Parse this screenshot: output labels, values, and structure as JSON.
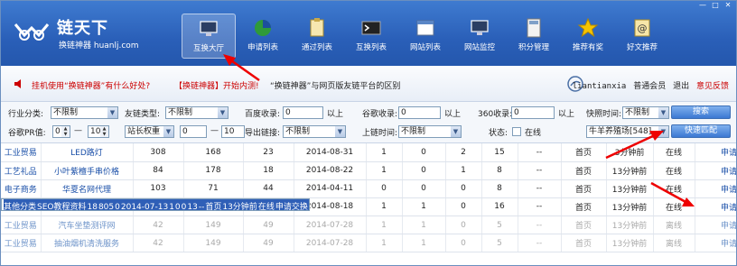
{
  "brand": {
    "name": "链天下",
    "sub": "换链神器 huanlj.com"
  },
  "window": {
    "min": "—",
    "max": "□",
    "close": "✕"
  },
  "nav": [
    {
      "label": "互换大厅",
      "icon": "monitor-icon",
      "active": true
    },
    {
      "label": "申请列表",
      "icon": "pie-chart-icon",
      "active": false
    },
    {
      "label": "通过列表",
      "icon": "clipboard-icon",
      "active": false
    },
    {
      "label": "互换列表",
      "icon": "terminal-icon",
      "active": false
    },
    {
      "label": "网站列表",
      "icon": "browser-window-icon",
      "active": false
    },
    {
      "label": "网站监控",
      "icon": "monitor-icon",
      "active": false
    },
    {
      "label": "积分管理",
      "icon": "calculator-icon",
      "active": false
    },
    {
      "label": "推荐有奖",
      "icon": "star-icon",
      "active": false
    },
    {
      "label": "好文推荐",
      "icon": "at-sign-icon",
      "active": false
    }
  ],
  "info": {
    "t1": "挂机使用“换链神器”有什么好处?",
    "t2": "【换链神器】开始内测!",
    "t3": "“换链神器”与网页版友链平台的区别"
  },
  "user": {
    "name": "liantianxia",
    "level": "普通会员",
    "logout": "退出",
    "feedback": "意见反馈"
  },
  "filter": {
    "industry_label": "行业分类:",
    "industry_value": "不限制",
    "linktype_label": "友链类型:",
    "linktype_value": "不限制",
    "baidu_label": "百度收录:",
    "baidu_value": "0",
    "baidu_unit": "以上",
    "google_label": "谷歌收录:",
    "google_value": "0",
    "google_unit": "以上",
    "s360_label": "360收录:",
    "s360_value": "0",
    "s360_unit": "以上",
    "snapshot_label": "快照时间:",
    "snapshot_value": "不限制",
    "search_btn": "搜索",
    "pr_label": "谷歌PR值:",
    "pr_from": "0",
    "pr_sep": "—",
    "pr_to": "10",
    "weight_value": "站长权重",
    "w_from": "0",
    "w_sep": "—",
    "w_to": "10",
    "outlinks_label": "导出链接:",
    "outlinks_value": "不限制",
    "online_time_label": "上链时间:",
    "online_time_value": "不限制",
    "status_label": "状态:",
    "status_option": "在线",
    "site_value": "牛羊养殖场[548]",
    "match_btn": "快速匹配"
  },
  "rows": [
    {
      "c": [
        "工业贸易",
        "LED路灯",
        "308",
        "168",
        "23",
        "2014-08-31",
        "1",
        "0",
        "2",
        "15",
        "--",
        "首页",
        "3分钟前",
        "在线",
        "申请交换"
      ],
      "state": "normal"
    },
    {
      "c": [
        "工艺礼品",
        "小叶紫檀手串价格",
        "84",
        "178",
        "18",
        "2014-08-22",
        "1",
        "0",
        "1",
        "8",
        "--",
        "首页",
        "13分钟前",
        "在线",
        "申请交换"
      ],
      "state": "normal"
    },
    {
      "c": [
        "电子商务",
        "华夏名网代理",
        "103",
        "71",
        "44",
        "2014-04-11",
        "0",
        "0",
        "0",
        "8",
        "--",
        "首页",
        "13分钟前",
        "在线",
        "申请交换"
      ],
      "state": "normal"
    },
    {
      "c": [
        "其他分类",
        "SEO教程资料",
        "18",
        "805",
        "0",
        "2014-07-13",
        "1",
        "0",
        "0",
        "13",
        "--",
        "首页",
        "13分钟前",
        "在线",
        "申请交换"
      ],
      "state": "selected"
    },
    {
      "c": [
        "工业贸易",
        "成都麻将机批发",
        "26",
        "162",
        "18",
        "2014-08-18",
        "1",
        "1",
        "0",
        "16",
        "--",
        "首页",
        "13分钟前",
        "在线",
        "申请交换"
      ],
      "state": "normal"
    },
    {
      "c": [
        "工业贸易",
        "汽车坐垫测评网",
        "42",
        "149",
        "49",
        "2014-07-28",
        "1",
        "1",
        "0",
        "5",
        "--",
        "首页",
        "13分钟前",
        "离线",
        "申请交换"
      ],
      "state": "dim"
    },
    {
      "c": [
        "工业贸易",
        "抽油烟机清洗服务",
        "42",
        "149",
        "49",
        "2014-07-28",
        "1",
        "1",
        "0",
        "5",
        "--",
        "首页",
        "13分钟前",
        "离线",
        "申请交换"
      ],
      "state": "dim"
    }
  ]
}
